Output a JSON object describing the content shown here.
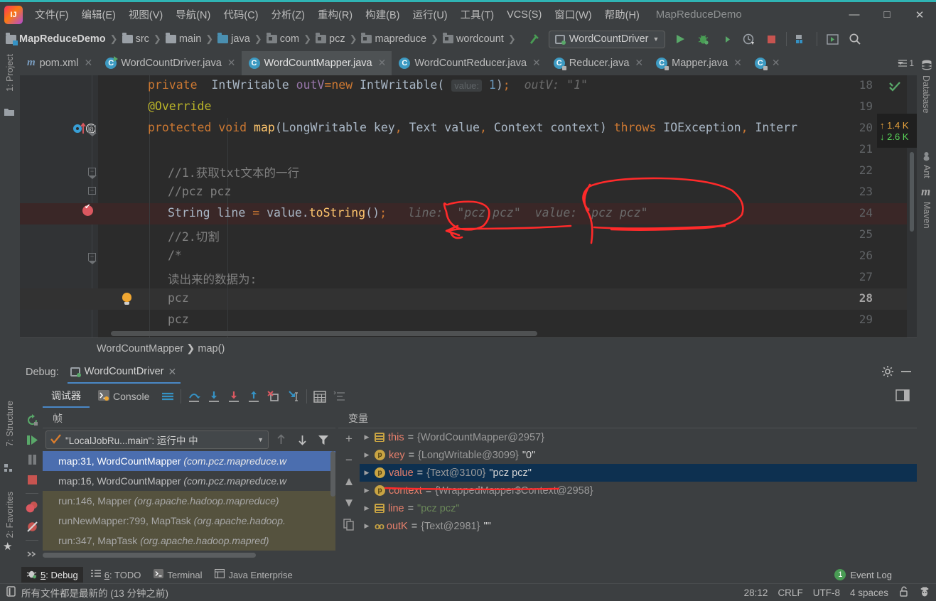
{
  "window": {
    "title": "MapReduceDemo",
    "minimize": "—",
    "maximize": "□",
    "close": "✕"
  },
  "menubar": {
    "items": [
      {
        "label": "文件(F)"
      },
      {
        "label": "编辑(E)"
      },
      {
        "label": "视图(V)"
      },
      {
        "label": "导航(N)"
      },
      {
        "label": "代码(C)"
      },
      {
        "label": "分析(Z)"
      },
      {
        "label": "重构(R)"
      },
      {
        "label": "构建(B)"
      },
      {
        "label": "运行(U)"
      },
      {
        "label": "工具(T)"
      },
      {
        "label": "VCS(S)"
      },
      {
        "label": "窗口(W)"
      },
      {
        "label": "帮助(H)"
      }
    ]
  },
  "breadcrumb": {
    "items": [
      "MapReduceDemo",
      "src",
      "main",
      "java",
      "com",
      "pcz",
      "mapreduce",
      "wordcount"
    ],
    "separator": "❯"
  },
  "run_config": {
    "name": "WordCountDriver",
    "caret": "▼"
  },
  "editor_tabs": [
    {
      "label": "pom.xml",
      "icon": "maven-m-icon",
      "active": false,
      "close": "✕"
    },
    {
      "label": "WordCountDriver.java",
      "icon": "class-run-icon",
      "active": false,
      "close": "✕"
    },
    {
      "label": "WordCountMapper.java",
      "icon": "class-icon",
      "active": true,
      "close": "✕"
    },
    {
      "label": "WordCountReducer.java",
      "icon": "class-icon",
      "active": false,
      "close": "✕"
    },
    {
      "label": "Reducer.java",
      "icon": "class-lock-icon",
      "active": false,
      "close": "✕"
    },
    {
      "label": "Mapper.java",
      "icon": "class-lock-icon",
      "active": false,
      "close": "✕"
    },
    {
      "label": "",
      "icon": "class-lock-icon",
      "active": false,
      "close": "✕"
    }
  ],
  "tabs_overflow": "1",
  "code": {
    "lines": [
      {
        "num": "18",
        "text": "private  IntWritable outV=new IntWritable( value: 1);   outV: \"1\""
      },
      {
        "num": "19",
        "text": "@Override"
      },
      {
        "num": "20",
        "text": "protected void map(LongWritable key, Text value, Context context) throws IOException, Interr"
      },
      {
        "num": "21",
        "text": ""
      },
      {
        "num": "22",
        "text": "//1.获取txt文本的一行"
      },
      {
        "num": "23",
        "text": "//pcz pcz"
      },
      {
        "num": "24",
        "text": "String line = value.toString();"
      },
      {
        "num": "25",
        "text": "//2.切割"
      },
      {
        "num": "26",
        "text": "/*"
      },
      {
        "num": "27",
        "text": "读出来的数据为:"
      },
      {
        "num": "28",
        "text": "pcz"
      },
      {
        "num": "29",
        "text": "pcz"
      }
    ],
    "inline_hints": {
      "line18_param": "value:",
      "line18_value": "1",
      "line18_result": "outV: \"1\"",
      "line24_line": "line:  \"pcz pcz\"",
      "line24_value": "value: \"pcz pcz\""
    }
  },
  "network_monitor": {
    "upload": "↑ 1.4 K",
    "download": "↓ 2.6 K"
  },
  "editor_breadcrumb": {
    "class": "WordCountMapper",
    "separator": "❯",
    "method": "map()"
  },
  "debug": {
    "label": "Debug:",
    "session": "WordCountDriver",
    "close": "✕",
    "tabs": [
      {
        "label": "调试器",
        "active": true
      },
      {
        "label": "Console",
        "active": false
      }
    ],
    "frames_title": "帧",
    "variables_title": "变量",
    "thread": "\"LocalJobRu...main\": 运行中 中",
    "frames": [
      {
        "method": "map:31, WordCountMapper",
        "pkg": "(com.pcz.mapreduce.w",
        "state": "selected"
      },
      {
        "method": "map:16, WordCountMapper",
        "pkg": "(com.pcz.mapreduce.w",
        "state": "normal"
      },
      {
        "method": "run:146, Mapper",
        "pkg": "(org.apache.hadoop.mapreduce)",
        "state": "library"
      },
      {
        "method": "runNewMapper:799, MapTask",
        "pkg": "(org.apache.hadoop.",
        "state": "library"
      },
      {
        "method": "run:347, MapTask",
        "pkg": "(org.apache.hadoop.mapred)",
        "state": "library"
      }
    ],
    "variables": [
      {
        "icon": "field-icon",
        "name": "this",
        "eq": "=",
        "ref": "{WordCountMapper@2957}",
        "value": "",
        "selected": false
      },
      {
        "icon": "param-icon",
        "name": "key",
        "eq": "=",
        "ref": "{LongWritable@3099}",
        "value": "\"0\"",
        "selected": false
      },
      {
        "icon": "param-icon",
        "name": "value",
        "eq": "=",
        "ref": "{Text@3100}",
        "value": "\"pcz pcz\"",
        "selected": true
      },
      {
        "icon": "param-icon",
        "name": "context",
        "eq": "=",
        "ref": "{WrappedMapper$Context@2958}",
        "value": "",
        "selected": false
      },
      {
        "icon": "field-icon",
        "name": "line",
        "eq": "=",
        "ref": "",
        "value": "\"pcz pcz\"",
        "selected": false
      },
      {
        "icon": "watch-icon",
        "name": "outK",
        "eq": "=",
        "ref": "{Text@2981}",
        "value": "\"\"",
        "selected": false
      }
    ]
  },
  "left_strip": {
    "project": "1: Project",
    "structure": "7: Structure",
    "favorites": "2: Favorites"
  },
  "right_strip": {
    "database": "Database",
    "ant": "Ant",
    "maven": "Maven"
  },
  "bottom_bar": {
    "items": [
      {
        "num": "5",
        "label": ": Debug",
        "icon": "bug-icon",
        "active": true
      },
      {
        "num": "6",
        "label": ": TODO",
        "icon": "list-icon",
        "active": false
      },
      {
        "num": "",
        "label": "Terminal",
        "icon": "terminal-icon",
        "active": false
      },
      {
        "num": "",
        "label": "Java Enterprise",
        "icon": "java-ee-icon",
        "active": false
      }
    ],
    "event_log": "Event Log",
    "event_count": "1"
  },
  "status_bar": {
    "message": "所有文件都是最新的 (13 分钟之前)",
    "position": "28:12",
    "line_sep": "CRLF",
    "encoding": "UTF-8",
    "indent": "4 spaces"
  },
  "colors": {
    "accent": "#2fb4b4",
    "selection": "#4b6eaf",
    "annotation": "#ff2a2a",
    "breakpoint": "#db5860",
    "run_green": "#59a869"
  }
}
